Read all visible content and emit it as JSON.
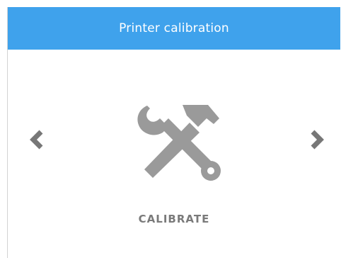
{
  "header": {
    "title": "Printer calibration",
    "background_color": "#3fa2ec",
    "text_color": "#ffffff"
  },
  "carousel": {
    "prev_icon": "chevron-left-icon",
    "next_icon": "chevron-right-icon",
    "current_item": {
      "icon": "wrench-hammer-icon",
      "label": "CALIBRATE"
    }
  },
  "colors": {
    "icon_gray": "#9a9a9a",
    "arrow_gray": "#777777",
    "label_gray": "#7a7a7a"
  }
}
